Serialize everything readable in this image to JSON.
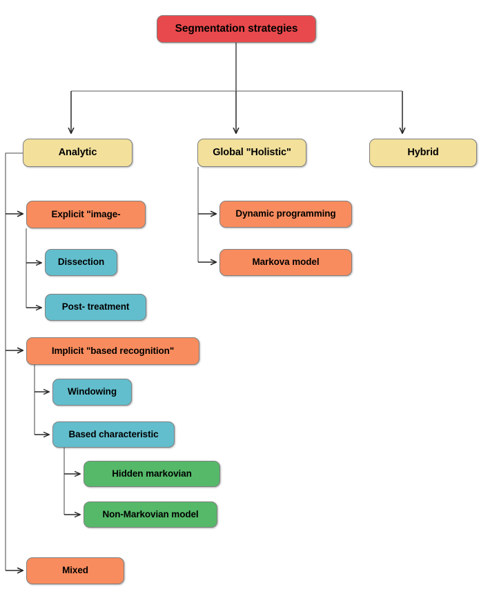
{
  "diagram": {
    "title": "Segmentation strategies",
    "type": "hierarchy-tree",
    "colors": {
      "root": "#e8494c",
      "level1": "#f2e09b",
      "level2": "#f98c5e",
      "level3": "#62becd",
      "level4": "#55b969",
      "connector": "#404040",
      "background": "#ffffff"
    },
    "nodes": {
      "root": {
        "label": "Segmentation strategies"
      },
      "analytic": {
        "label": "Analytic"
      },
      "global": {
        "label": "Global \"Holistic\""
      },
      "hybrid": {
        "label": "Hybrid"
      },
      "explicit": {
        "label": "Explicit \"image-"
      },
      "dissection": {
        "label": "Dissection"
      },
      "post_treatment": {
        "label": "Post- treatment"
      },
      "implicit": {
        "label": "Implicit \"based recognition\""
      },
      "windowing": {
        "label": "Windowing"
      },
      "based_characteristic": {
        "label": "Based characteristic"
      },
      "hidden_markovian": {
        "label": "Hidden markovian"
      },
      "non_markovian": {
        "label": "Non-Markovian model"
      },
      "mixed": {
        "label": "Mixed"
      },
      "dynamic_programming": {
        "label": "Dynamic programming"
      },
      "markova_model": {
        "label": "Markova model"
      }
    }
  }
}
